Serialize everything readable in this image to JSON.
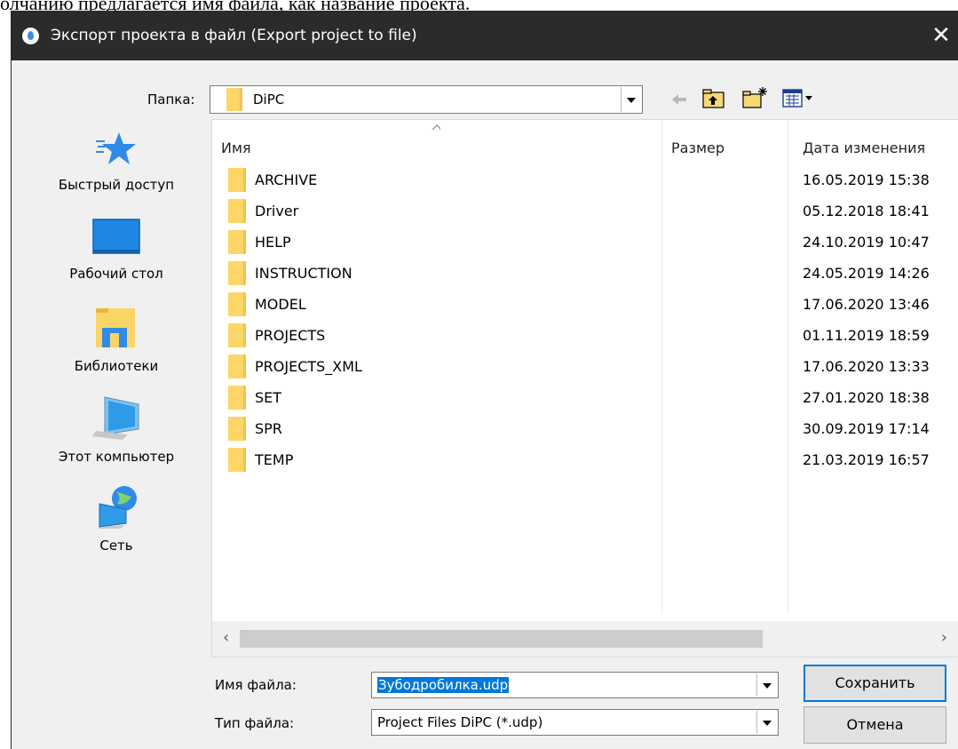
{
  "above_text": "олчанию предлагается имя файла, как название проекта.",
  "window": {
    "title": "Экспорт проекта в файл (Export project to file)",
    "close_glyph": "✕"
  },
  "look_in": {
    "label": "Папка:",
    "value": "DiPC"
  },
  "toolbar": {
    "back_icon": "back-arrow-icon",
    "up_icon": "up-folder-icon",
    "new_folder_icon": "new-folder-icon",
    "view_icon": "view-menu-icon"
  },
  "places": [
    {
      "label": "Быстрый доступ",
      "icon": "quick-access-star-icon"
    },
    {
      "label": "Рабочий стол",
      "icon": "desktop-icon"
    },
    {
      "label": "Библиотеки",
      "icon": "libraries-icon"
    },
    {
      "label": "Этот компьютер",
      "icon": "computer-icon"
    },
    {
      "label": "Сеть",
      "icon": "network-icon"
    }
  ],
  "columns": {
    "name": "Имя",
    "size": "Размер",
    "date": "Дата изменения"
  },
  "files": [
    {
      "name": "ARCHIVE",
      "date": "16.05.2019 15:38"
    },
    {
      "name": "Driver",
      "date": "05.12.2018 18:41"
    },
    {
      "name": "HELP",
      "date": "24.10.2019 10:47"
    },
    {
      "name": "INSTRUCTION",
      "date": "24.05.2019 14:26"
    },
    {
      "name": "MODEL",
      "date": "17.06.2020 13:46"
    },
    {
      "name": "PROJECTS",
      "date": "01.11.2019 18:59"
    },
    {
      "name": "PROJECTS_XML",
      "date": "17.06.2020 13:33"
    },
    {
      "name": "SET",
      "date": "27.01.2020 18:38"
    },
    {
      "name": "SPR",
      "date": "30.09.2019 17:14"
    },
    {
      "name": "TEMP",
      "date": "21.03.2019 16:57"
    }
  ],
  "filename": {
    "label": "Имя файла:",
    "value": "Зубодробилка.udp"
  },
  "filetype": {
    "label": "Тип файла:",
    "value": "Project Files DiPC (*.udp)"
  },
  "buttons": {
    "save": "Сохранить",
    "cancel": "Отмена"
  }
}
